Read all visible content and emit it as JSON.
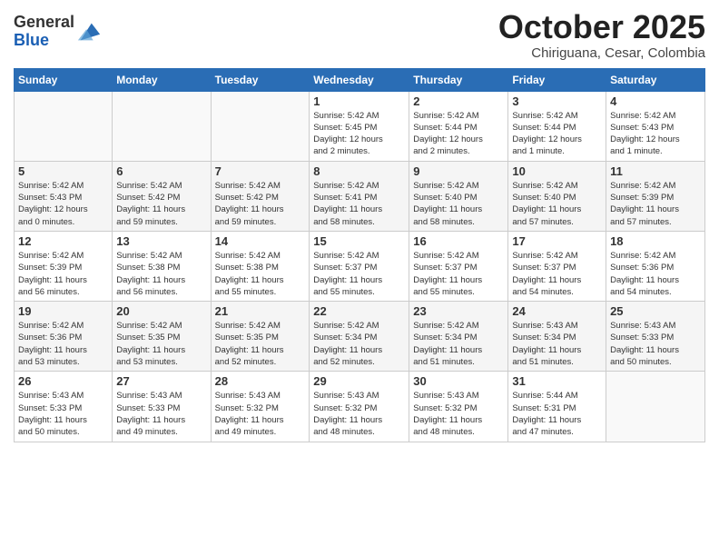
{
  "logo": {
    "general": "General",
    "blue": "Blue"
  },
  "header": {
    "month": "October 2025",
    "location": "Chiriguana, Cesar, Colombia"
  },
  "weekdays": [
    "Sunday",
    "Monday",
    "Tuesday",
    "Wednesday",
    "Thursday",
    "Friday",
    "Saturday"
  ],
  "weeks": [
    [
      {
        "day": "",
        "info": ""
      },
      {
        "day": "",
        "info": ""
      },
      {
        "day": "",
        "info": ""
      },
      {
        "day": "1",
        "info": "Sunrise: 5:42 AM\nSunset: 5:45 PM\nDaylight: 12 hours\nand 2 minutes."
      },
      {
        "day": "2",
        "info": "Sunrise: 5:42 AM\nSunset: 5:44 PM\nDaylight: 12 hours\nand 2 minutes."
      },
      {
        "day": "3",
        "info": "Sunrise: 5:42 AM\nSunset: 5:44 PM\nDaylight: 12 hours\nand 1 minute."
      },
      {
        "day": "4",
        "info": "Sunrise: 5:42 AM\nSunset: 5:43 PM\nDaylight: 12 hours\nand 1 minute."
      }
    ],
    [
      {
        "day": "5",
        "info": "Sunrise: 5:42 AM\nSunset: 5:43 PM\nDaylight: 12 hours\nand 0 minutes."
      },
      {
        "day": "6",
        "info": "Sunrise: 5:42 AM\nSunset: 5:42 PM\nDaylight: 11 hours\nand 59 minutes."
      },
      {
        "day": "7",
        "info": "Sunrise: 5:42 AM\nSunset: 5:42 PM\nDaylight: 11 hours\nand 59 minutes."
      },
      {
        "day": "8",
        "info": "Sunrise: 5:42 AM\nSunset: 5:41 PM\nDaylight: 11 hours\nand 58 minutes."
      },
      {
        "day": "9",
        "info": "Sunrise: 5:42 AM\nSunset: 5:40 PM\nDaylight: 11 hours\nand 58 minutes."
      },
      {
        "day": "10",
        "info": "Sunrise: 5:42 AM\nSunset: 5:40 PM\nDaylight: 11 hours\nand 57 minutes."
      },
      {
        "day": "11",
        "info": "Sunrise: 5:42 AM\nSunset: 5:39 PM\nDaylight: 11 hours\nand 57 minutes."
      }
    ],
    [
      {
        "day": "12",
        "info": "Sunrise: 5:42 AM\nSunset: 5:39 PM\nDaylight: 11 hours\nand 56 minutes."
      },
      {
        "day": "13",
        "info": "Sunrise: 5:42 AM\nSunset: 5:38 PM\nDaylight: 11 hours\nand 56 minutes."
      },
      {
        "day": "14",
        "info": "Sunrise: 5:42 AM\nSunset: 5:38 PM\nDaylight: 11 hours\nand 55 minutes."
      },
      {
        "day": "15",
        "info": "Sunrise: 5:42 AM\nSunset: 5:37 PM\nDaylight: 11 hours\nand 55 minutes."
      },
      {
        "day": "16",
        "info": "Sunrise: 5:42 AM\nSunset: 5:37 PM\nDaylight: 11 hours\nand 55 minutes."
      },
      {
        "day": "17",
        "info": "Sunrise: 5:42 AM\nSunset: 5:37 PM\nDaylight: 11 hours\nand 54 minutes."
      },
      {
        "day": "18",
        "info": "Sunrise: 5:42 AM\nSunset: 5:36 PM\nDaylight: 11 hours\nand 54 minutes."
      }
    ],
    [
      {
        "day": "19",
        "info": "Sunrise: 5:42 AM\nSunset: 5:36 PM\nDaylight: 11 hours\nand 53 minutes."
      },
      {
        "day": "20",
        "info": "Sunrise: 5:42 AM\nSunset: 5:35 PM\nDaylight: 11 hours\nand 53 minutes."
      },
      {
        "day": "21",
        "info": "Sunrise: 5:42 AM\nSunset: 5:35 PM\nDaylight: 11 hours\nand 52 minutes."
      },
      {
        "day": "22",
        "info": "Sunrise: 5:42 AM\nSunset: 5:34 PM\nDaylight: 11 hours\nand 52 minutes."
      },
      {
        "day": "23",
        "info": "Sunrise: 5:42 AM\nSunset: 5:34 PM\nDaylight: 11 hours\nand 51 minutes."
      },
      {
        "day": "24",
        "info": "Sunrise: 5:43 AM\nSunset: 5:34 PM\nDaylight: 11 hours\nand 51 minutes."
      },
      {
        "day": "25",
        "info": "Sunrise: 5:43 AM\nSunset: 5:33 PM\nDaylight: 11 hours\nand 50 minutes."
      }
    ],
    [
      {
        "day": "26",
        "info": "Sunrise: 5:43 AM\nSunset: 5:33 PM\nDaylight: 11 hours\nand 50 minutes."
      },
      {
        "day": "27",
        "info": "Sunrise: 5:43 AM\nSunset: 5:33 PM\nDaylight: 11 hours\nand 49 minutes."
      },
      {
        "day": "28",
        "info": "Sunrise: 5:43 AM\nSunset: 5:32 PM\nDaylight: 11 hours\nand 49 minutes."
      },
      {
        "day": "29",
        "info": "Sunrise: 5:43 AM\nSunset: 5:32 PM\nDaylight: 11 hours\nand 48 minutes."
      },
      {
        "day": "30",
        "info": "Sunrise: 5:43 AM\nSunset: 5:32 PM\nDaylight: 11 hours\nand 48 minutes."
      },
      {
        "day": "31",
        "info": "Sunrise: 5:44 AM\nSunset: 5:31 PM\nDaylight: 11 hours\nand 47 minutes."
      },
      {
        "day": "",
        "info": ""
      }
    ]
  ]
}
